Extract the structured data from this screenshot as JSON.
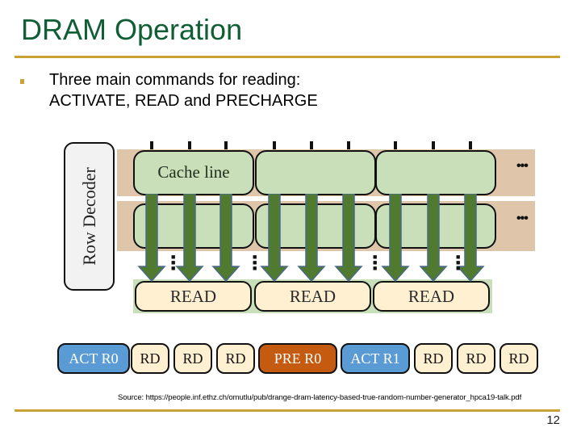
{
  "slide": {
    "title": "DRAM Operation",
    "bullet_line1": "Three main commands for reading:",
    "bullet_line2": "ACTIVATE, READ and PRECHARGE",
    "source": "Source: https://people.inf.ethz.ch/omutlu/pub/drange-dram-latency-based-true-random-number-generator_hpca19-talk.pdf",
    "page_number": "12"
  },
  "diagram": {
    "row_decoder_label": "Row Decoder",
    "cache_line_label": "Cache line",
    "more_columns_symbol": "•••",
    "more_rows_symbol": "•\n•\n•",
    "read_buffers": [
      "READ",
      "READ",
      "READ"
    ],
    "commands": [
      {
        "label": "ACT R0",
        "type": "activate"
      },
      {
        "label": "RD",
        "type": "read"
      },
      {
        "label": "RD",
        "type": "read"
      },
      {
        "label": "RD",
        "type": "read"
      },
      {
        "label": "PRE R0",
        "type": "precharge"
      },
      {
        "label": "ACT R1",
        "type": "activate"
      },
      {
        "label": "RD",
        "type": "read"
      },
      {
        "label": "RD",
        "type": "read"
      },
      {
        "label": "RD",
        "type": "read"
      }
    ],
    "colors": {
      "title": "#0f5e36",
      "accent_rule": "#c8a234",
      "row_band": "#dfc6ab",
      "cell": "#c9dfba",
      "arrow": "#4f7a30",
      "arrow_edge": "#4a6b88",
      "read_buffer": "#fff0d2",
      "activate": "#5b9bd5",
      "precharge": "#c55a11",
      "read": "#fff0d2"
    }
  }
}
